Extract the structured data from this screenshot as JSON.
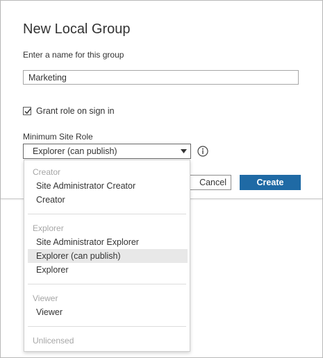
{
  "dialog": {
    "title": "New Local Group",
    "prompt": "Enter a name for this group",
    "name_value": "Marketing",
    "grant_role_label": "Grant role on sign in",
    "grant_role_checked": true,
    "min_role_label": "Minimum Site Role",
    "selected_role": "Explorer (can publish)",
    "cancel_label": "Cancel",
    "create_label": "Create",
    "create_color": "#1f6aa5"
  },
  "dropdown": {
    "groups": [
      {
        "header": "Creator",
        "options": [
          "Site Administrator Creator",
          "Creator"
        ]
      },
      {
        "header": "Explorer",
        "options": [
          "Site Administrator Explorer",
          "Explorer (can publish)",
          "Explorer"
        ]
      },
      {
        "header": "Viewer",
        "options": [
          "Viewer"
        ]
      },
      {
        "header": "Unlicensed",
        "options": []
      }
    ],
    "highlighted_option": "Explorer (can publish)"
  }
}
